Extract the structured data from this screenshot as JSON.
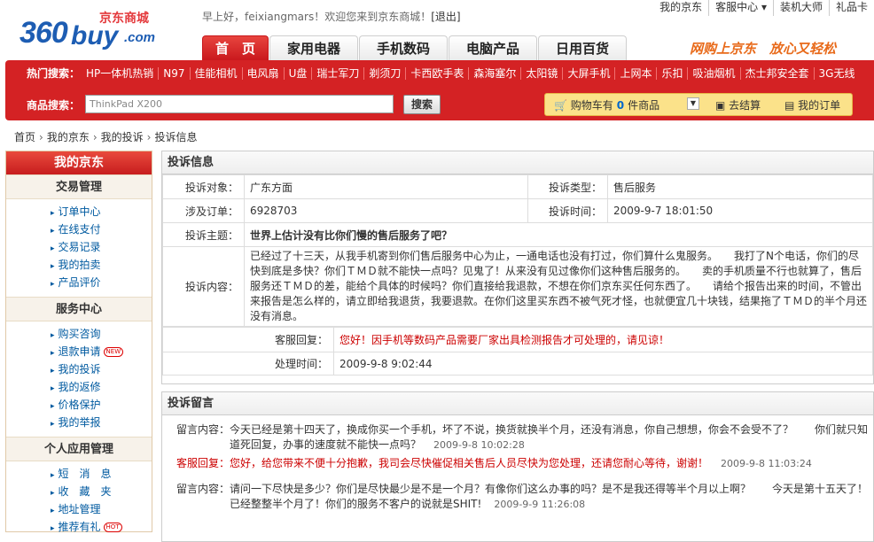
{
  "logo": {
    "num": "360",
    "buy": "buy",
    "com": ".com",
    "cn": "京东商城"
  },
  "welcome": {
    "greeting": "早上好，",
    "user": "feixiangmars",
    "tail": "！欢迎您来到京东商城！",
    "logout": "[退出]"
  },
  "toplinks": [
    "我的京东",
    "客服中心 ▾",
    "装机大师",
    "礼品卡"
  ],
  "slogan": "网购上京东　放心又轻松",
  "tabs": [
    "首　页",
    "家用电器",
    "手机数码",
    "电脑产品",
    "日用百货"
  ],
  "hot": {
    "label": "热门搜索：",
    "items": [
      "HP一体机热销",
      "N97",
      "佳能相机",
      "电风扇",
      "U盘",
      "瑞士军刀",
      "剃须刀",
      "卡西欧手表",
      "森海塞尔",
      "太阳镜",
      "大屏手机",
      "上网本",
      "乐扣",
      "吸油烟机",
      "杰士邦安全套",
      "3G无线"
    ]
  },
  "search": {
    "label": "商品搜索：",
    "value": "ThinkPad X200",
    "button": "搜索"
  },
  "cart": {
    "label": "购物车有",
    "count": "0",
    "unit": "件商品",
    "checkout": "去结算",
    "orders": "我的订单"
  },
  "breadcrumb": [
    "首页",
    "我的京东",
    "我的投诉",
    "投诉信息"
  ],
  "sidebar": {
    "title": "我的京东",
    "sections": [
      {
        "title": "交易管理",
        "items": [
          "订单中心",
          "在线支付",
          "交易记录",
          "我的拍卖",
          "产品评价"
        ]
      },
      {
        "title": "服务中心",
        "items": [
          "购买咨询",
          "退款申请",
          "我的投诉",
          "我的返修",
          "价格保护",
          "我的举报"
        ],
        "new_badge": "NEW"
      },
      {
        "title": "个人应用管理",
        "items": [
          "短　消　息",
          "收　藏　夹",
          "地址管理",
          "推荐有礼"
        ],
        "hot_badge": "HOT"
      }
    ]
  },
  "complaint": {
    "title": "投诉信息",
    "target_label": "投诉对象：",
    "target": "广东方面",
    "type_label": "投诉类型：",
    "type": "售后服务",
    "order_label": "涉及订单：",
    "order": "6928703",
    "time_label": "投诉时间：",
    "time": "2009-9-7 18:01:50",
    "subject_label": "投诉主题：",
    "subject": "世界上估计没有比你们慢的售后服务了吧？",
    "content_label": "投诉内容：",
    "content": "已经过了十三天，从我手机寄到你们售后服务中心为止，一通电话也没有打过，你们算什么鬼服务。　　我打了N个电话，你们的尽快到底是多快？你们ＴＭＤ就不能快一点吗？见鬼了！从来没有见过像你们这种售后服务的。　　卖的手机质量不行也就算了，售后服务还ＴＭＤ的差，能给个具体的时候吗？你们直接给我退款，不想在你们京东买任何东西了。　　请给个报告出来的时间，不管出来报告是怎么样的，请立即给我退货，我要退款。在你们这里买东西不被气死才怪，也就便宜几十块钱，结果拖了ＴＭＤ的半个月还没有消息。",
    "reply_label": "客服回复：",
    "reply": "您好！因手机等数码产品需要厂家出具检测报告才可处理的，请见谅！",
    "handle_label": "处理时间：",
    "handle_time": "2009-9-8 9:02:44"
  },
  "messages": {
    "title": "投诉留言",
    "items": [
      {
        "label": "留言内容：",
        "text": "今天已经是第十四天了，换成你买一个手机，坏了不说，换货就换半个月，还没有消息，你自己想想，你会不会受不了？　　你们就只知道死回复，办事的速度就不能快一点吗？",
        "time": "2009-9-8 10:02:28",
        "reply": false
      },
      {
        "label": "客服回复：",
        "text": "您好，给您带来不便十分抱歉，我司会尽快催促相关售后人员尽快为您处理，还请您耐心等待，谢谢！",
        "time": "2009-9-8 11:03:24",
        "reply": true
      },
      {
        "label": "留言内容：",
        "text": "请问一下尽快是多少？你们是尽快最少是不是一个月？有像你们这么办事的吗？是不是我还得等半个月以上啊？　　今天是第十五天了！已经整整半个月了！你们的服务不客户的说就是SHIT!",
        "time": "2009-9-9 11:26:08",
        "reply": false
      }
    ]
  },
  "colors": {
    "brand_red": "#d42224",
    "link_blue": "#005aa0",
    "logo_blue": "#1d5db3",
    "slogan_orange": "#e86a1a"
  }
}
